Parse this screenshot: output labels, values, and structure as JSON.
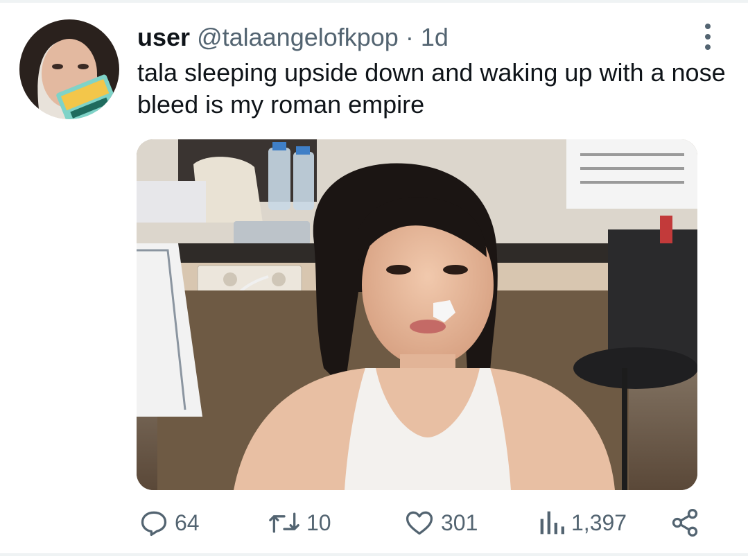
{
  "tweet": {
    "display_name": "user",
    "handle": "@talaangelofkpop",
    "separator": "·",
    "time": "1d",
    "text": "tala sleeping upside down and waking up with a nose bleed is my roman empire"
  },
  "actions": {
    "reply_count": "64",
    "retweet_count": "10",
    "like_count": "301",
    "view_count": "1,397"
  },
  "icons": {
    "reply": "reply-icon",
    "retweet": "retweet-icon",
    "like": "heart-icon",
    "views": "views-icon",
    "share": "share-icon",
    "more": "more-vertical-icon"
  },
  "colors": {
    "text": "#0f1419",
    "secondary": "#536471"
  }
}
